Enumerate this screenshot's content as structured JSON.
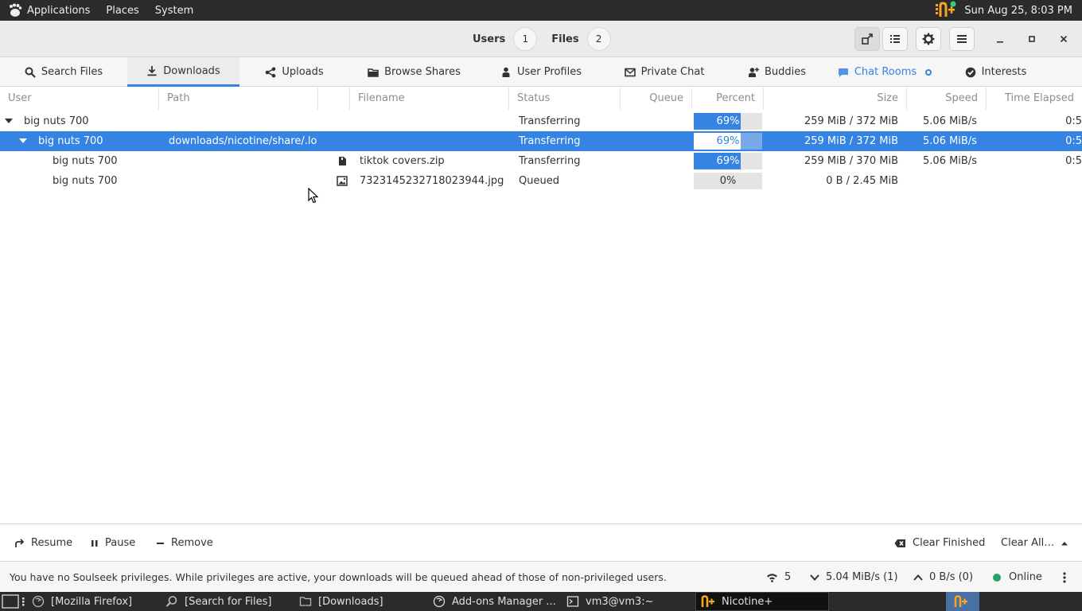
{
  "top_panel": {
    "menus": [
      "Applications",
      "Places",
      "System"
    ],
    "clock": "Sun Aug 25,  8:03 PM"
  },
  "header": {
    "users_label": "Users",
    "users_count": "1",
    "files_label": "Files",
    "files_count": "2"
  },
  "tabs": [
    {
      "label": "Search Files",
      "icon": "search-icon"
    },
    {
      "label": "Downloads",
      "icon": "download-icon"
    },
    {
      "label": "Uploads",
      "icon": "share-icon"
    },
    {
      "label": "Browse Shares",
      "icon": "folder-icon"
    },
    {
      "label": "User Profiles",
      "icon": "person-icon"
    },
    {
      "label": "Private Chat",
      "icon": "mail-icon"
    },
    {
      "label": "Buddies",
      "icon": "add-user-icon"
    },
    {
      "label": "Chat Rooms",
      "icon": "chat-icon"
    },
    {
      "label": "Interests",
      "icon": "check-circle-icon"
    }
  ],
  "columns": [
    "User",
    "Path",
    "Filename",
    "Status",
    "Queue",
    "Percent",
    "Size",
    "Speed",
    "Time Elapsed"
  ],
  "rows": [
    {
      "user": "big nuts 700",
      "path": "",
      "filename": "",
      "status": "Transferring",
      "percent": 69,
      "percent_text": "69%",
      "size": "259 MiB / 372 MiB",
      "speed": "5.06 MiB/s",
      "elapsed": "0:5"
    },
    {
      "user": "big nuts 700",
      "path": "downloads/nicotine/share/.local",
      "filename": "",
      "status": "Transferring",
      "percent": 69,
      "percent_text": "69%",
      "size": "259 MiB / 372 MiB",
      "speed": "5.06 MiB/s",
      "elapsed": "0:5"
    },
    {
      "user": "big nuts 700",
      "path": "",
      "filename": "tiktok covers.zip",
      "status": "Transferring",
      "percent": 69,
      "percent_text": "69%",
      "size": "259 MiB / 370 MiB",
      "speed": "5.06 MiB/s",
      "elapsed": "0:5"
    },
    {
      "user": "big nuts 700",
      "path": "",
      "filename": "7323145232718023944.jpg",
      "status": "Queued",
      "percent": 0,
      "percent_text": "0%",
      "size": "0 B / 2.45 MiB",
      "speed": "",
      "elapsed": ""
    }
  ],
  "actions": {
    "resume": "Resume",
    "pause": "Pause",
    "remove": "Remove",
    "clear_finished": "Clear Finished",
    "clear_all": "Clear All…"
  },
  "status": {
    "message": "You have no Soulseek privileges. While privileges are active, your downloads will be queued ahead of those of non-privileged users.",
    "connections": "5",
    "download_speed": "5.04 MiB/s (1)",
    "upload_speed": "0 B/s (0)",
    "online": "Online"
  },
  "taskbar": [
    {
      "label": "[Mozilla Firefox]"
    },
    {
      "label": "[Search for Files]"
    },
    {
      "label": "[Downloads]"
    },
    {
      "label": "Add-ons Manager ..."
    },
    {
      "label": "vm3@vm3:~"
    },
    {
      "label": "Nicotine+"
    }
  ],
  "colors": {
    "accent": "#3584e4",
    "online": "#26a269"
  }
}
